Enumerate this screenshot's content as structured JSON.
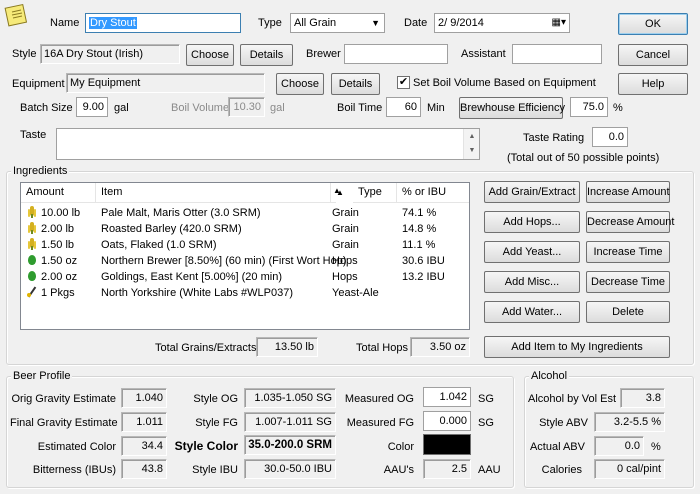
{
  "header": {
    "name_label": "Name",
    "name_value": "Dry Stout",
    "type_label": "Type",
    "type_value": "All Grain",
    "date_label": "Date",
    "date_value": "2/ 9/2014",
    "ok_label": "OK",
    "cancel_label": "Cancel",
    "help_label": "Help"
  },
  "style_row": {
    "style_label": "Style",
    "style_value": "16A Dry Stout (Irish)",
    "choose_label": "Choose",
    "details_label": "Details",
    "brewer_label": "Brewer",
    "brewer_value": "",
    "assistant_label": "Assistant",
    "assistant_value": ""
  },
  "equipment_row": {
    "equipment_label": "Equipment",
    "equipment_value": "My Equipment",
    "choose_label": "Choose",
    "details_label": "Details",
    "set_boil_label": "Set Boil Volume Based on Equipment",
    "set_boil_checked": "✔"
  },
  "batch_row": {
    "batch_label": "Batch Size",
    "batch_value": "9.00",
    "batch_unit": "gal",
    "boil_vol_label": "Boil Volume",
    "boil_vol_value": "10.30",
    "boil_vol_unit": "gal",
    "boil_time_label": "Boil Time",
    "boil_time_value": "60",
    "boil_time_unit": "Min",
    "efficiency_label": "Brewhouse Efficiency",
    "efficiency_value": "75.0",
    "efficiency_unit": "%"
  },
  "taste": {
    "label": "Taste",
    "value": "",
    "rating_label": "Taste Rating",
    "rating_value": "0.0",
    "rating_note": "(Total out of 50 possible points)"
  },
  "ingredients": {
    "group_label": "Ingredients",
    "columns": {
      "amount": "Amount",
      "item": "Item",
      "sort": "▲",
      "type": "Type",
      "pct": "% or IBU"
    },
    "rows": [
      {
        "icon": "grain",
        "amount": "10.00 lb",
        "item": "Pale Malt, Maris Otter (3.0 SRM)",
        "type": "Grain",
        "pct": "74.1 %"
      },
      {
        "icon": "grain",
        "amount": "2.00 lb",
        "item": "Roasted Barley (420.0 SRM)",
        "type": "Grain",
        "pct": "14.8 %"
      },
      {
        "icon": "grain",
        "amount": "1.50 lb",
        "item": "Oats, Flaked (1.0 SRM)",
        "type": "Grain",
        "pct": "11.1 %"
      },
      {
        "icon": "hop",
        "amount": "1.50 oz",
        "item": "Northern Brewer [8.50%]  (60 min) (First Wort Hop)",
        "type": "Hops",
        "pct": "30.6 IBU"
      },
      {
        "icon": "hop",
        "amount": "2.00 oz",
        "item": "Goldings, East Kent [5.00%]  (20 min)",
        "type": "Hops",
        "pct": "13.2 IBU"
      },
      {
        "icon": "yeast",
        "amount": "1 Pkgs",
        "item": "North Yorkshire (White Labs #WLP037)",
        "type": "Yeast-Ale",
        "pct": ""
      }
    ],
    "buttons": {
      "add_grain": "Add Grain/Extract",
      "increase_amount": "Increase Amount",
      "add_hops": "Add Hops...",
      "decrease_amount": "Decrease Amount",
      "add_yeast": "Add Yeast...",
      "increase_time": "Increase Time",
      "add_misc": "Add Misc...",
      "decrease_time": "Decrease Time",
      "add_water": "Add Water...",
      "delete": "Delete",
      "add_to_my": "Add Item to My Ingredients"
    },
    "total_grains_label": "Total Grains/Extracts",
    "total_grains_value": "13.50 lb",
    "total_hops_label": "Total Hops",
    "total_hops_value": "3.50 oz"
  },
  "beer_profile": {
    "group_label": "Beer Profile",
    "og_label": "Orig Gravity Estimate",
    "og_value": "1.040",
    "fg_label": "Final Gravity Estimate",
    "fg_value": "1.011",
    "color_label": "Estimated Color",
    "color_value": "34.4",
    "ibu_label": "Bitterness (IBUs)",
    "ibu_value": "43.8",
    "style_og_label": "Style OG",
    "style_og_value": "1.035-1.050 SG",
    "style_fg_label": "Style FG",
    "style_fg_value": "1.007-1.011 SG",
    "style_color_label": "Style Color",
    "style_color_value": "35.0-200.0 SRM",
    "style_ibu_label": "Style IBU",
    "style_ibu_value": "30.0-50.0 IBU",
    "measured_og_label": "Measured OG",
    "measured_og_value": "1.042",
    "measured_og_unit": "SG",
    "measured_fg_label": "Measured FG",
    "measured_fg_value": "0.000",
    "measured_fg_unit": "SG",
    "color_swatch_label": "Color",
    "swatch_color": "#000000",
    "aau_label": "AAU's",
    "aau_value": "2.5",
    "aau_unit": "AAU"
  },
  "alcohol": {
    "group_label": "Alcohol",
    "abv_est_label": "Alcohol by Vol Est",
    "abv_est_value": "3.8",
    "style_abv_label": "Style ABV",
    "style_abv_value": "3.2-5.5 %",
    "actual_abv_label": "Actual ABV",
    "actual_abv_value": "0.0",
    "actual_abv_unit": "%",
    "calories_label": "Calories",
    "calories_value": "0 cal/pint"
  }
}
